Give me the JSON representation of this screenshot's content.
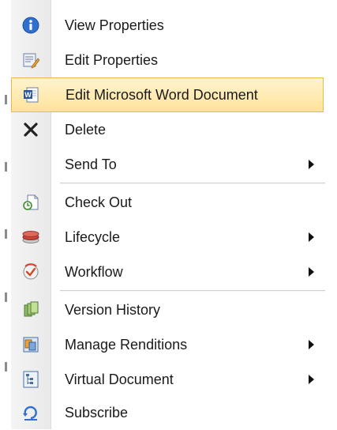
{
  "menu": {
    "items": [
      {
        "label": "View Properties",
        "icon": "info-icon",
        "submenu": false
      },
      {
        "label": "Edit Properties",
        "icon": "edit-properties-icon",
        "submenu": false
      },
      {
        "label": "Edit Microsoft Word Document",
        "icon": "word-document-icon",
        "submenu": false,
        "highlighted": true
      },
      {
        "label": "Delete",
        "icon": "delete-x-icon",
        "submenu": false
      },
      {
        "label": "Send To",
        "icon": "",
        "submenu": true
      },
      {
        "label": "Check Out",
        "icon": "check-out-icon",
        "submenu": false
      },
      {
        "label": "Lifecycle",
        "icon": "lifecycle-icon",
        "submenu": true
      },
      {
        "label": "Workflow",
        "icon": "workflow-icon",
        "submenu": true
      },
      {
        "label": "Version History",
        "icon": "version-history-icon",
        "submenu": false
      },
      {
        "label": "Manage Renditions",
        "icon": "renditions-icon",
        "submenu": true
      },
      {
        "label": "Virtual Document",
        "icon": "virtual-document-icon",
        "submenu": true
      },
      {
        "label": "Subscribe",
        "icon": "subscribe-icon",
        "submenu": false
      }
    ]
  },
  "colors": {
    "highlight_top": "#fff3cf",
    "highlight_bottom": "#ffe39a",
    "highlight_border": "#e9b949",
    "info_blue": "#2f6fcf"
  }
}
